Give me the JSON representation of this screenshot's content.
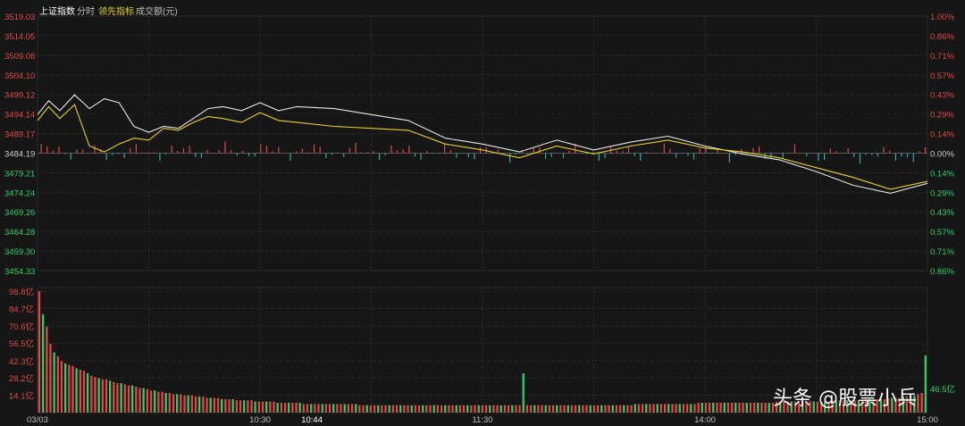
{
  "header": {
    "index_name": "上证指数",
    "mode": "分时",
    "indicator": "领先指标",
    "volume_label": "成交额(元)"
  },
  "watermark": "头条 @股票小兵",
  "colors": {
    "background": "#161616",
    "grid": "#2a2a2a",
    "up": "#e04848",
    "down": "#2bb0b0",
    "vol_up": "#e04848",
    "vol_down": "#2bd06a",
    "price_line": "#e8e8e8",
    "lead_line": "#e6d21e",
    "axis_up_text": "#e04848",
    "axis_down_text": "#2bd06a"
  },
  "chart_data": [
    {
      "type": "line",
      "title": "上证指数 分时",
      "x_ticks": [
        "03/03",
        "10:30",
        "10:44",
        "11:30",
        "14:00",
        "15:00"
      ],
      "ylim": [
        3454.33,
        3519.03
      ],
      "y_ticks_left": [
        "3519.03",
        "3514.05",
        "3509.08",
        "3504.10",
        "3499.12",
        "3494.14",
        "3489.17",
        "3484.19",
        "3479.21",
        "3474.24",
        "3469.26",
        "3464.28",
        "3459.30",
        "3454.33"
      ],
      "y_ticks_right": [
        "1.00%",
        "0.86%",
        "0.71%",
        "0.57%",
        "0.43%",
        "0.29%",
        "0.14%",
        "0.00%",
        "0.14%",
        "0.29%",
        "0.43%",
        "0.57%",
        "0.71%",
        "0.86%"
      ],
      "baseline": 3484.19,
      "series": [
        {
          "name": "price",
          "x": [
            0,
            3,
            6,
            10,
            14,
            18,
            22,
            26,
            30,
            34,
            38,
            42,
            46,
            50,
            55,
            60,
            65,
            70,
            80,
            90,
            100,
            110,
            120,
            130,
            140,
            150,
            160,
            170,
            180,
            190,
            200,
            210,
            220,
            230,
            240
          ],
          "values": [
            3494.0,
            3497.5,
            3495.0,
            3499.0,
            3495.5,
            3498.0,
            3497.0,
            3491.0,
            3489.5,
            3491.0,
            3490.5,
            3493.0,
            3495.5,
            3496.0,
            3495.0,
            3497.0,
            3495.0,
            3496.0,
            3495.5,
            3494.0,
            3492.5,
            3488.0,
            3486.5,
            3484.5,
            3487.5,
            3485.0,
            3487.0,
            3488.5,
            3486.0,
            3484.0,
            3482.5,
            3479.5,
            3476.0,
            3474.0,
            3476.5
          ]
        },
        {
          "name": "leading",
          "x": [
            0,
            3,
            6,
            10,
            14,
            18,
            22,
            26,
            30,
            34,
            38,
            42,
            46,
            50,
            55,
            60,
            65,
            70,
            80,
            90,
            100,
            110,
            120,
            130,
            140,
            150,
            160,
            170,
            180,
            190,
            200,
            210,
            220,
            230,
            240
          ],
          "values": [
            3492.5,
            3496.0,
            3493.0,
            3496.5,
            3486.0,
            3484.5,
            3486.5,
            3488.0,
            3487.5,
            3490.5,
            3490.0,
            3492.0,
            3493.5,
            3493.0,
            3492.0,
            3494.5,
            3492.5,
            3492.0,
            3491.0,
            3490.5,
            3490.0,
            3486.5,
            3485.0,
            3483.0,
            3486.0,
            3484.0,
            3486.0,
            3487.5,
            3485.5,
            3484.5,
            3483.0,
            3480.5,
            3478.0,
            3475.0,
            3477.0
          ]
        }
      ]
    },
    {
      "type": "bar",
      "title": "成交额(元)",
      "y_ticks": [
        "98.8亿",
        "84.7亿",
        "70.6亿",
        "56.5亿",
        "42.3亿",
        "28.2亿",
        "14.1亿"
      ],
      "ylim": [
        0,
        98.8
      ],
      "last_value_label": "46.5亿",
      "values": [
        98.8,
        80,
        70,
        56,
        49,
        46,
        42,
        40,
        39,
        38,
        36,
        35,
        34,
        32,
        30,
        29,
        28,
        27,
        27,
        26,
        25,
        24,
        24,
        23,
        22,
        22,
        21,
        20,
        20,
        19,
        18,
        18,
        17,
        17,
        16,
        16,
        15,
        15,
        15,
        14,
        14,
        14,
        13,
        13,
        13,
        12,
        12,
        12,
        12,
        11,
        11,
        11,
        11,
        10,
        10,
        10,
        10,
        10,
        9,
        9,
        9,
        9,
        9,
        9,
        8,
        8,
        8,
        8,
        8,
        8,
        8,
        7,
        7,
        7,
        7,
        7,
        7,
        7,
        7,
        7,
        7,
        7,
        7,
        7,
        7,
        7,
        6,
        6,
        6,
        6,
        6,
        6,
        6,
        6,
        6,
        6,
        6,
        6,
        6,
        6,
        6,
        6,
        6,
        6,
        6,
        6,
        6,
        6,
        6,
        6,
        6,
        6,
        6,
        6,
        6,
        6,
        6,
        6,
        6,
        6,
        6,
        6,
        6,
        6,
        6,
        6,
        6,
        6,
        6,
        6,
        32,
        6,
        6,
        6,
        6,
        6,
        6,
        6,
        6,
        6,
        6,
        6,
        6,
        6,
        6,
        6,
        6,
        6,
        6,
        6,
        6,
        6,
        6,
        6,
        6,
        6,
        6,
        6,
        6,
        6,
        7,
        7,
        7,
        7,
        7,
        7,
        7,
        7,
        7,
        7,
        7,
        7,
        7,
        7,
        7,
        7,
        7,
        8,
        8,
        8,
        8,
        8,
        8,
        8,
        8,
        8,
        8,
        8,
        8,
        8,
        8,
        8,
        8,
        8,
        8,
        8,
        8,
        8,
        9,
        9,
        9,
        9,
        9,
        9,
        9,
        9,
        9,
        9,
        9,
        9,
        9,
        9,
        9,
        10,
        10,
        10,
        10,
        10,
        10,
        10,
        10,
        10,
        11,
        11,
        11,
        11,
        11,
        11,
        12,
        12,
        12,
        12,
        13,
        13,
        14,
        14,
        15,
        16,
        46.5
      ]
    }
  ]
}
